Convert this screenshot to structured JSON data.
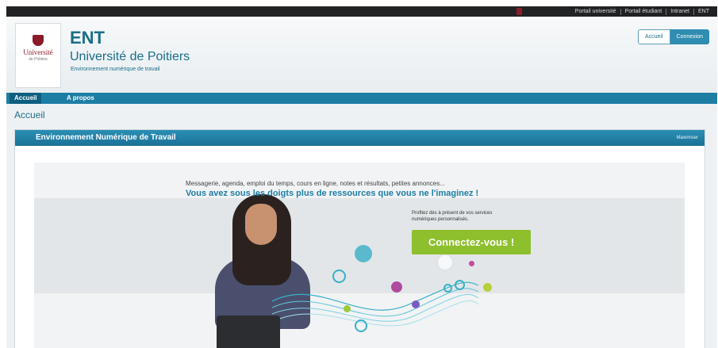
{
  "topbar": {
    "links": [
      "Portail université",
      "Portail étudiant",
      "Intranet",
      "ENT"
    ]
  },
  "header": {
    "logo_name": "Université",
    "logo_sub": "de Poitiers",
    "title": "ENT",
    "university": "Université de Poitiers",
    "subtitle": "Environnement numérique de travail",
    "btn_home": "Accueil",
    "btn_login": "Connexion"
  },
  "nav": {
    "items": [
      "Accueil",
      "A propos"
    ]
  },
  "page": {
    "title": "Accueil"
  },
  "portlet": {
    "title": "Environnement Numérique de Travail",
    "maximize": "Maximiser"
  },
  "banner": {
    "tagline_small": "Messagerie, agenda, emploi du temps, cours en ligne, notes et résultats, petites annonces...",
    "tagline_big": "Vous avez sous les doigts plus de ressources que vous ne l'imaginez !",
    "promo": "Profitez dès à présent de vos services numériques personnalisés.",
    "cta": "Connectez-vous !"
  },
  "colors": {
    "brand_blue": "#1d7ea4",
    "cta_green": "#8ebf2d",
    "university_red": "#8b1b2a"
  }
}
